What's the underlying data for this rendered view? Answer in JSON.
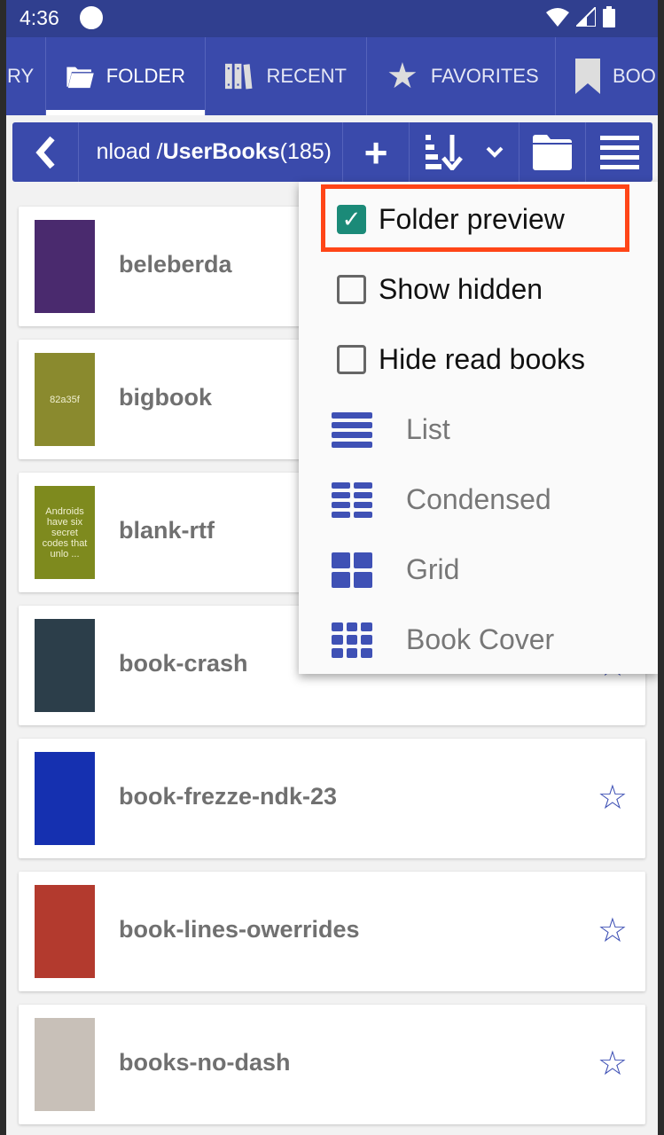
{
  "status": {
    "time": "4:36"
  },
  "tabs": [
    {
      "label": "RY",
      "icon": "library-icon"
    },
    {
      "label": "FOLDER",
      "icon": "folder-icon",
      "active": true
    },
    {
      "label": "RECENT",
      "icon": "books-icon"
    },
    {
      "label": "FAVORITES",
      "icon": "star-icon"
    },
    {
      "label": "BOO",
      "icon": "bookmark-icon"
    }
  ],
  "toolbar": {
    "path_prefix": "nload / ",
    "folder": "UserBooks",
    "count": " (185)"
  },
  "books": [
    {
      "title": "beleberda",
      "cover_color": "#4a2a6e",
      "cover_text": ""
    },
    {
      "title": "bigbook",
      "cover_color": "#8a8a2e",
      "cover_text": "82a35f"
    },
    {
      "title": "blank-rtf",
      "cover_color": "#7e8a1e",
      "cover_text": "Androids have six secret codes that unlo ..."
    },
    {
      "title": "book-crash",
      "cover_color": "#2c3e4a",
      "cover_text": ""
    },
    {
      "title": "book-frezze-ndk-23",
      "cover_color": "#1530b0",
      "cover_text": ""
    },
    {
      "title": "book-lines-owerrides",
      "cover_color": "#b33a2e",
      "cover_text": ""
    },
    {
      "title": "books-no-dash",
      "cover_color": "#c8c0b8",
      "cover_text": ""
    }
  ],
  "menu": {
    "checks": [
      {
        "label": "Folder preview",
        "checked": true
      },
      {
        "label": "Show hidden",
        "checked": false
      },
      {
        "label": "Hide read books",
        "checked": false
      }
    ],
    "views": [
      {
        "label": "List",
        "icon": "list-icon"
      },
      {
        "label": "Condensed",
        "icon": "condensed-list-icon"
      },
      {
        "label": "Grid",
        "icon": "grid-icon"
      },
      {
        "label": "Book Cover",
        "icon": "book-cover-grid-icon"
      }
    ]
  },
  "colors": {
    "primary": "#3a4aab",
    "status": "#303f8f",
    "checkbox": "#1b8a78",
    "highlight": "#ff4517",
    "star": "#3f51b5"
  }
}
